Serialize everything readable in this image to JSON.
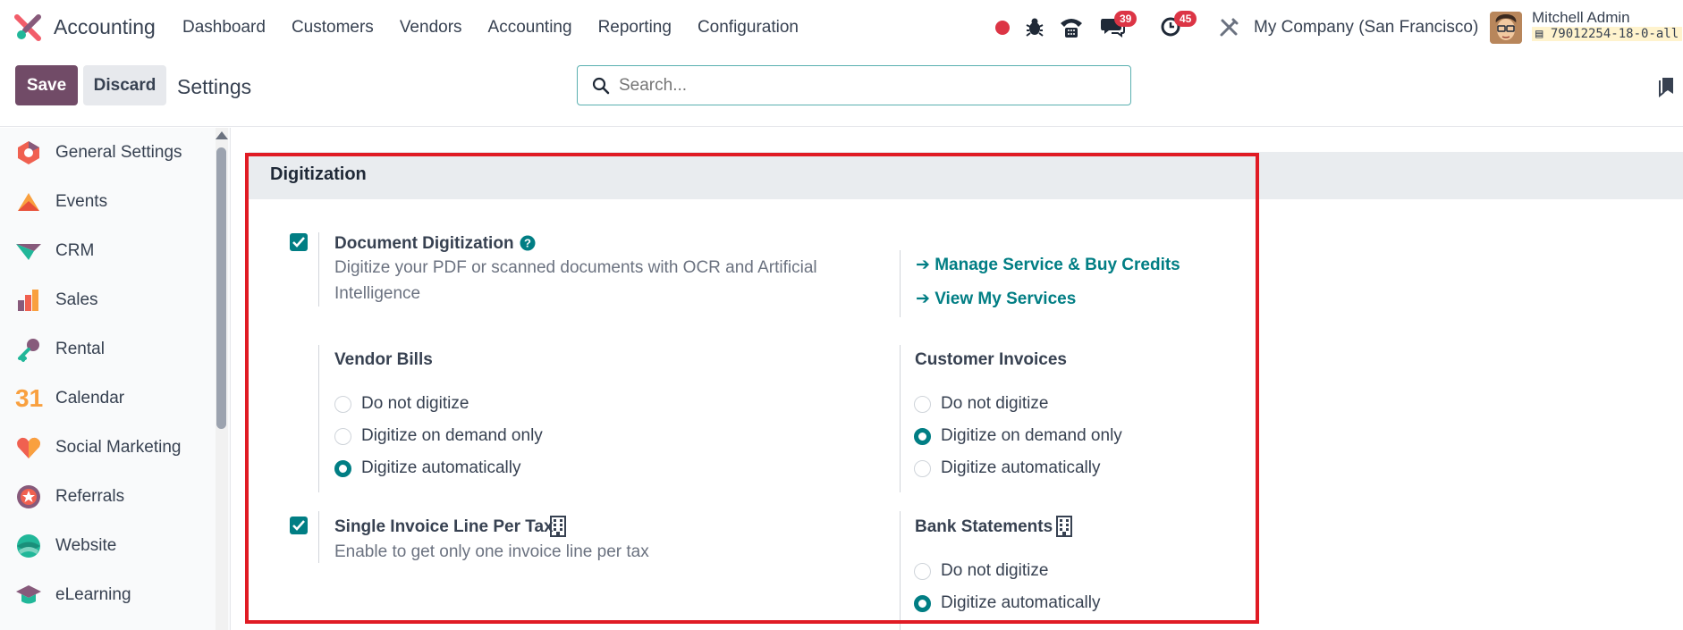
{
  "navbar": {
    "app_name": "Accounting",
    "menu": [
      "Dashboard",
      "Customers",
      "Vendors",
      "Accounting",
      "Reporting",
      "Configuration"
    ],
    "messages_count": "39",
    "activities_count": "45",
    "company": "My Company (San Francisco)",
    "user_name": "Mitchell Admin",
    "database": "79012254-18-0-all"
  },
  "control": {
    "save_label": "Save",
    "discard_label": "Discard",
    "title": "Settings",
    "search_placeholder": "Search..."
  },
  "sidebar": {
    "items": [
      {
        "label": "General Settings",
        "icon": "general-settings-icon"
      },
      {
        "label": "Events",
        "icon": "events-icon"
      },
      {
        "label": "CRM",
        "icon": "crm-icon"
      },
      {
        "label": "Sales",
        "icon": "sales-icon"
      },
      {
        "label": "Rental",
        "icon": "rental-icon"
      },
      {
        "label": "Calendar",
        "icon": "calendar-icon"
      },
      {
        "label": "Social Marketing",
        "icon": "social-marketing-icon"
      },
      {
        "label": "Referrals",
        "icon": "referrals-icon"
      },
      {
        "label": "Website",
        "icon": "website-icon"
      },
      {
        "label": "eLearning",
        "icon": "elearning-icon"
      }
    ],
    "calendar_number": "31"
  },
  "section": {
    "title": "Digitization",
    "doc_digitization": {
      "title": "Document Digitization",
      "description": "Digitize your PDF or scanned documents with OCR and Artificial Intelligence",
      "checked": true
    },
    "links": {
      "manage": "Manage Service & Buy Credits",
      "view": "View My Services",
      "arrow": "➔"
    },
    "vendor_bills": {
      "title": "Vendor Bills",
      "options": [
        "Do not digitize",
        "Digitize on demand only",
        "Digitize automatically"
      ],
      "selected": "Digitize automatically"
    },
    "customer_invoices": {
      "title": "Customer Invoices",
      "options": [
        "Do not digitize",
        "Digitize on demand only",
        "Digitize automatically"
      ],
      "selected": "Digitize on demand only"
    },
    "single_line": {
      "title": "Single Invoice Line Per Tax",
      "description": "Enable to get only one invoice line per tax",
      "checked": true
    },
    "bank_statements": {
      "title": "Bank Statements",
      "options": [
        "Do not digitize",
        "Digitize automatically"
      ],
      "selected": "Digitize automatically"
    }
  },
  "colors": {
    "primary": "#714b67",
    "accent": "#017e84",
    "highlight": "#e01b24",
    "badge": "#dc3545"
  }
}
